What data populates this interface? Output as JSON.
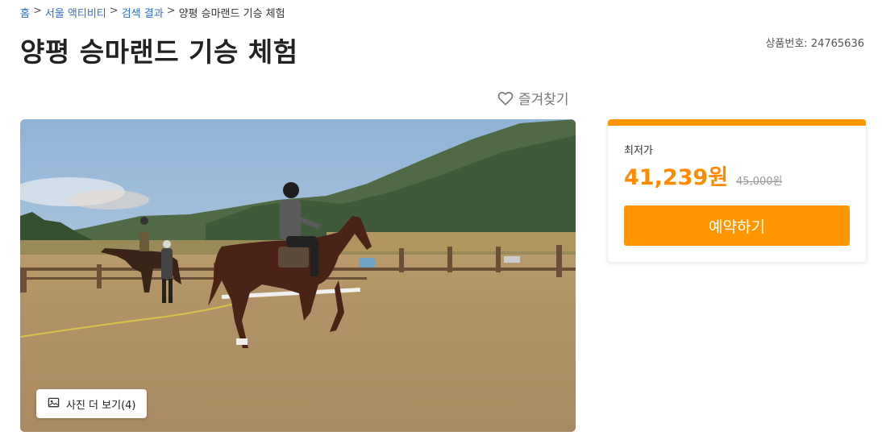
{
  "breadcrumb": {
    "home": "홈",
    "category": "서울 액티비티",
    "results": "검색 결과",
    "current": "양평 승마랜드 기승 체험",
    "separator": ">"
  },
  "title": "양평 승마랜드 기승 체험",
  "product_number": "상품번호: 24765636",
  "favorite": {
    "label": "즐겨찾기",
    "icon": "heart-outline-icon"
  },
  "gallery": {
    "more_label": "사진 더 보기(4)",
    "icon": "image-icon",
    "image_description_icon": "horse-riding-photo"
  },
  "price": {
    "label": "최저가",
    "current": "41,239원",
    "original": "45,000원",
    "reserve_label": "예약하기"
  },
  "colors": {
    "accent": "#ff9600",
    "price_text": "#ff8a00",
    "link": "#2f6fd1"
  }
}
